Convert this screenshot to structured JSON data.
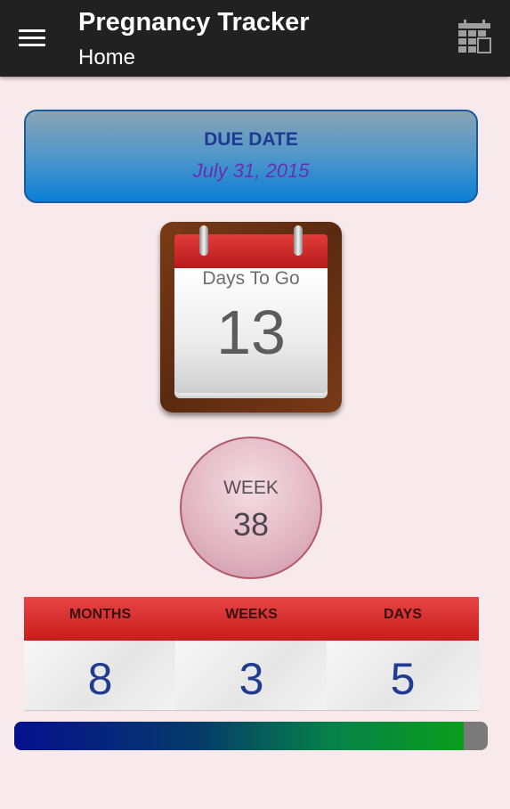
{
  "appbar": {
    "title": "Pregnancy Tracker",
    "subtitle": "Home",
    "menu_icon": "menu-icon",
    "calendar_icon": "calendar-icon",
    "background": "#212121"
  },
  "due_date": {
    "label": "DUE DATE",
    "value": "July 31, 2015"
  },
  "days_to_go": {
    "label": "Days To Go",
    "value": "13"
  },
  "week": {
    "label": "WEEK",
    "value": "38"
  },
  "counters": [
    {
      "label": "MONTHS",
      "value": "8"
    },
    {
      "label": "WEEKS",
      "value": "3"
    },
    {
      "label": "DAYS",
      "value": "5"
    }
  ],
  "progress": {
    "fraction": 0.95
  },
  "colors": {
    "accent_blue": "#1f3c8f",
    "header_red": "#c81c1c",
    "background": "#f8eaec"
  }
}
